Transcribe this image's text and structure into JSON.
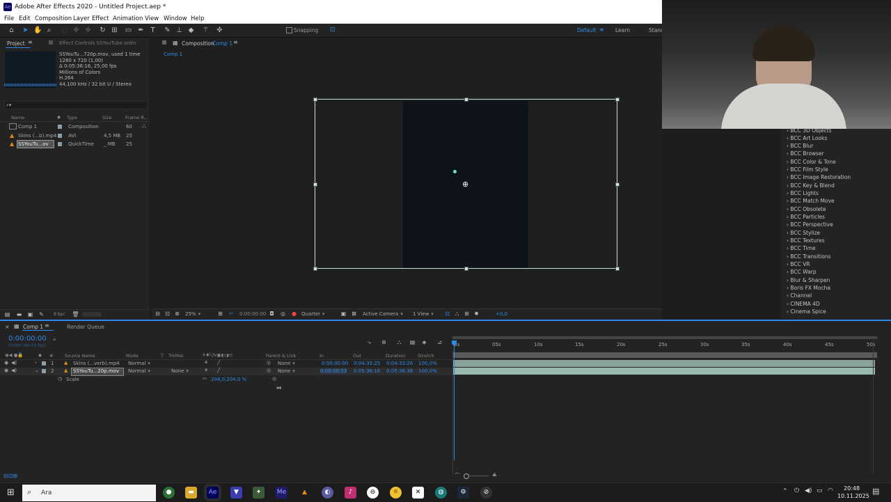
{
  "window": {
    "title": "Adobe After Effects 2020 - Untitled Project.aep *",
    "app_icon": "Ae"
  },
  "menu": [
    "File",
    "Edit",
    "Composition",
    "Layer",
    "Effect",
    "Animation",
    "View",
    "Window",
    "Help"
  ],
  "toolbar": {
    "snapping_label": "Snapping",
    "workspaces": [
      "Default",
      "Learn",
      "Stand"
    ],
    "tools": [
      "home-icon",
      "selection-icon",
      "hand-icon",
      "zoom-icon",
      "orbit-icon",
      "move-icon",
      "rotate-icon",
      "mask-rect-icon",
      "pen-icon",
      "type-icon",
      "brush-icon",
      "clone-stamp-icon",
      "eraser-icon",
      "roto-brush-icon",
      "puppet-icon"
    ]
  },
  "project_panel": {
    "tab_label": "Project",
    "effect_controls_label": "Effect Controls SSYouTube.onlin",
    "preview_info": {
      "name": "SSYouTu...720p.mov",
      "used": ", used 1 time",
      "dims": "1280 x 720 (1,00)",
      "duration": "Δ 0:05:36:16, 25,00 fps",
      "colors": "Millions of Colors",
      "codec": "H.264",
      "audio": "44,100 kHz / 32 bit U / Stereo"
    },
    "search_placeholder": "⌕▾",
    "headers": {
      "name": "Name",
      "type": "Type",
      "size": "Size",
      "frame_rate": "Frame R..."
    },
    "items": [
      {
        "name": "Comp 1",
        "type": "Composition",
        "size": "",
        "fps": "60",
        "color": "#8c9fa8"
      },
      {
        "name": "Skins (...b).mp4",
        "type": "AVI",
        "size": "4,5 MB",
        "fps": "25",
        "color": "#8c9fa8"
      },
      {
        "name": "SSYouTu...ov",
        "type": "QuickTime",
        "size": "_ MB",
        "fps": "25",
        "color": "#8c9fa8"
      }
    ],
    "bpc": "8 bpc"
  },
  "composition_panel": {
    "tab_label": "Composition",
    "tab_comp": "Comp 1",
    "breadcrumb": "Comp 1",
    "zoom": "25%",
    "timecode": "0:00:00:00",
    "resolution": "Quarter",
    "camera": "Active Camera",
    "views": "1 View",
    "exposure": "+0,0"
  },
  "effects_list": [
    "BCC 3D Objects",
    "BCC Art Looks",
    "BCC Blur",
    "BCC Browser",
    "BCC Color & Tone",
    "BCC Film Style",
    "BCC Image Restoration",
    "BCC Key & Blend",
    "BCC Lights",
    "BCC Match Move",
    "BCC Obsolete",
    "BCC Particles",
    "BCC Perspective",
    "BCC Stylize",
    "BCC Textures",
    "BCC Time",
    "BCC Transitions",
    "BCC VR",
    "BCC Warp",
    "Blur & Sharpen",
    "Boris FX Mocha",
    "Channel",
    "CINEMA 4D",
    "Cinema Spice"
  ],
  "timeline": {
    "tabs": [
      "Comp 1",
      "Render Queue"
    ],
    "current_time": "0:00:00:00",
    "current_time_sub": "00000 (60.00 fps)",
    "headers": {
      "source": "Source Name",
      "mode": "Mode",
      "t": "T",
      "trkmat": "TrkMat",
      "parent": "Parent & Link",
      "in": "In",
      "out": "Out",
      "duration": "Duration",
      "stretch": "Stretch"
    },
    "layers": [
      {
        "num": "1",
        "name": "Skins (...verb).mp4",
        "mode": "Normal",
        "trkmat": "",
        "parent": "None",
        "in": "0:00:00:00",
        "out": "0:04:33:25",
        "duration": "0:04:33:26",
        "stretch": "100,0%"
      },
      {
        "num": "2",
        "name": "SSYouTu...20p.mov",
        "mode": "Normal",
        "trkmat": "None",
        "parent": "None",
        "in": "0:00:00:23",
        "out": "0:05:36:16",
        "duration": "0:05:36:38",
        "stretch": "100,0%"
      }
    ],
    "property": {
      "name": "Scale",
      "value": "204,0,204,0 %"
    },
    "ruler": [
      "0s",
      "05s",
      "10s",
      "15s",
      "20s",
      "25s",
      "30s",
      "35s",
      "40s",
      "45s",
      "50s"
    ]
  },
  "taskbar": {
    "search_text": "Ara",
    "time": "20:48",
    "date": "10.11.2025",
    "apps": [
      "chrome-icon",
      "explorer-icon",
      "after-effects-icon",
      "brave-icon",
      "app-icon",
      "media-encoder-icon",
      "vlc-icon",
      "app-icon",
      "tiktok-icon",
      "app-icon",
      "maps-icon",
      "capcut-icon",
      "app-icon",
      "steam-icon",
      "app-icon"
    ],
    "app_labels": [
      "",
      "",
      "Ae",
      "",
      "",
      "Me",
      "",
      "",
      "",
      "",
      "",
      "",
      "",
      "",
      ""
    ]
  }
}
